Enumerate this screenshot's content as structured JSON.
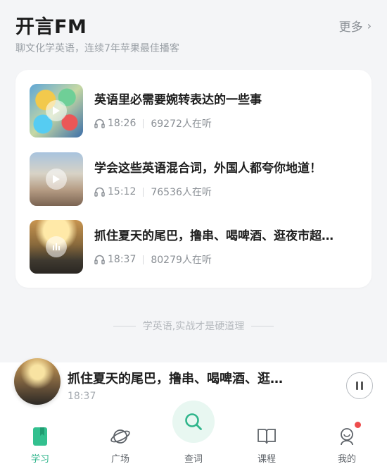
{
  "header": {
    "title": "开言FM",
    "more_label": "更多",
    "subtitle": "聊文化学英语，连续7年苹果最佳播客"
  },
  "episodes": [
    {
      "title": "英语里必需要婉转表达的一些事",
      "duration": "18:26",
      "listeners": "69272人在听"
    },
    {
      "title": "学会这些英语混合词，外国人都夸你地道！",
      "duration": "15:12",
      "listeners": "76536人在听"
    },
    {
      "title": "抓住夏天的尾巴，撸串、喝啤酒、逛夜市超…",
      "duration": "18:37",
      "listeners": "80279人在听"
    }
  ],
  "slogan": "学英语,实战才是硬道理",
  "player": {
    "title": "抓住夏天的尾巴，撸串、喝啤酒、逛…",
    "time": "18:37"
  },
  "tabs": [
    {
      "label": "学习",
      "icon": "book-icon",
      "active": true
    },
    {
      "label": "广场",
      "icon": "planet-icon",
      "active": false
    },
    {
      "label": "查词",
      "icon": "search-icon",
      "active": false
    },
    {
      "label": "课程",
      "icon": "open-book-icon",
      "active": false
    },
    {
      "label": "我的",
      "icon": "profile-icon",
      "active": false
    }
  ],
  "colors": {
    "accent": "#2fb58b",
    "badge": "#ee4c4c",
    "background": "#f4f5f7"
  }
}
